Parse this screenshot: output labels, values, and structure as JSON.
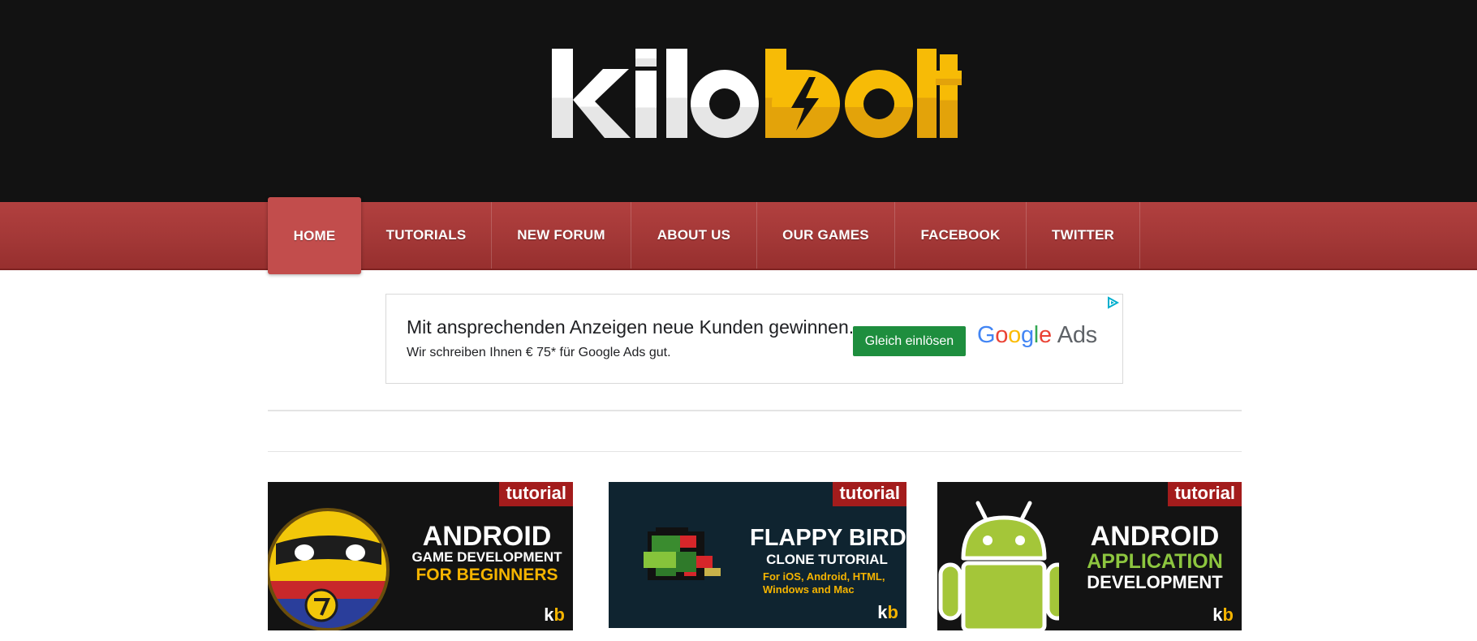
{
  "header": {
    "logo_text_left": "kilo",
    "logo_text_right": "bolt",
    "colors": {
      "background": "#121212",
      "logo_white": "#ffffff",
      "logo_gold": "#f5b400"
    }
  },
  "nav": {
    "items": [
      {
        "label": "HOME",
        "active": true
      },
      {
        "label": "TUTORIALS",
        "active": false
      },
      {
        "label": "NEW FORUM",
        "active": false
      },
      {
        "label": "ABOUT US",
        "active": false
      },
      {
        "label": "OUR GAMES",
        "active": false
      },
      {
        "label": "FACEBOOK",
        "active": false
      },
      {
        "label": "TWITTER",
        "active": false
      }
    ],
    "colors": {
      "bar": "#a33837",
      "active": "#c24d4c"
    }
  },
  "ad": {
    "headline": "Mit ansprechenden Anzeigen neue Kunden gewinnen.",
    "description": "Wir schreiben Ihnen € 75* für Google Ads gut.",
    "button_label": "Gleich einlösen",
    "brand_google": "Google",
    "brand_ads": "Ads",
    "adchoices_icon": "adchoices-triangle-icon"
  },
  "cards": [
    {
      "tag": "tutorial",
      "title_1": "ANDROID",
      "title_2": "GAME DEVELOPMENT",
      "title_3": "FOR BEGINNERS",
      "logo": "kb",
      "icon": "ninja-mascot-icon"
    },
    {
      "tag": "tutorial",
      "title_1": "FLAPPY BIRD",
      "title_2": "CLONE TUTORIAL",
      "title_3": "For iOS, Android, HTML,",
      "title_4": "Windows and Mac",
      "logo": "kb",
      "icon": "pixel-bird-icon"
    },
    {
      "tag": "tutorial",
      "title_1": "ANDROID",
      "title_2": "APPLICATION",
      "title_3": "DEVELOPMENT",
      "logo": "kb",
      "icon": "android-robot-icon"
    }
  ]
}
